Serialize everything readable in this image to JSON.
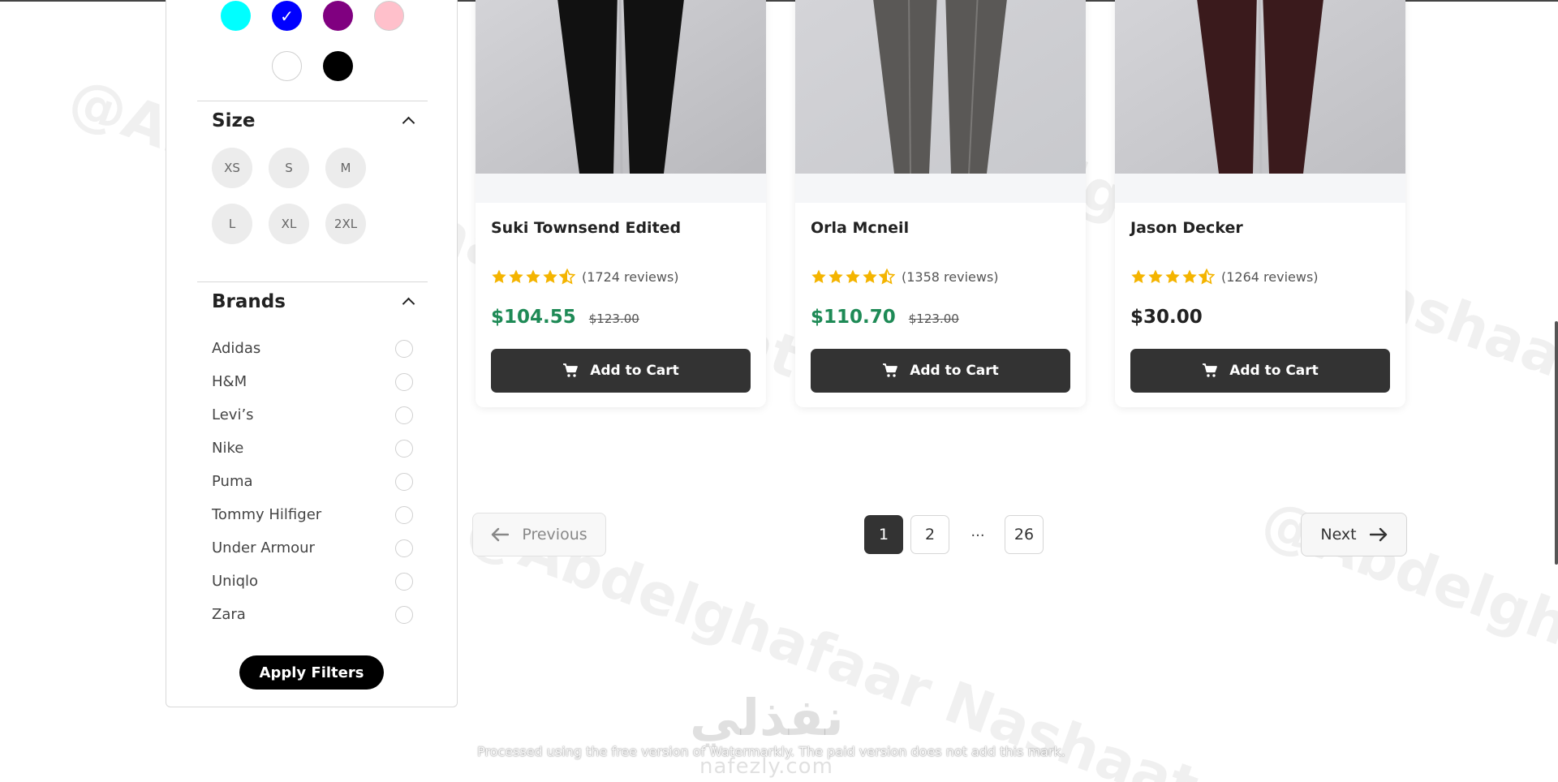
{
  "filters": {
    "colors": {
      "row1": [
        {
          "hex": "#00ffff",
          "selected": false
        },
        {
          "hex": "#0000ff",
          "selected": true
        },
        {
          "hex": "#800080",
          "selected": false
        },
        {
          "hex": "#ffc0cb",
          "selected": false
        }
      ],
      "row2": [
        {
          "hex": "#ffffff",
          "selected": false
        },
        {
          "hex": "#000000",
          "selected": false
        }
      ],
      "check_glyph": "✓"
    },
    "size": {
      "title": "Size",
      "row1": [
        "XS",
        "S",
        "M"
      ],
      "row2": [
        "L",
        "XL",
        "2XL"
      ]
    },
    "brands": {
      "title": "Brands",
      "items": [
        "Adidas",
        "H&M",
        "Levi’s",
        "Nike",
        "Puma",
        "Tommy Hilfiger",
        "Under Armour",
        "Uniqlo",
        "Zara"
      ]
    },
    "apply_label": "Apply Filters"
  },
  "products": [
    {
      "title": "Suki Townsend Edited",
      "reviews": "(1724 reviews)",
      "rating": 4.5,
      "price": "$104.55",
      "old_price": "$123.00",
      "cart_label": "Add to Cart",
      "pants_color": "#111111",
      "bg_color": "#b9b9bd"
    },
    {
      "title": "Orla Mcneil",
      "reviews": "(1358 reviews)",
      "rating": 4.5,
      "price": "$110.70",
      "old_price": "$123.00",
      "cart_label": "Add to Cart",
      "pants_color": "#5a5856",
      "bg_color": "#c8c9cd"
    },
    {
      "title": "Jason Decker",
      "reviews": "(1264 reviews)",
      "rating": 4.5,
      "price": "$30.00",
      "old_price": "",
      "cart_label": "Add to Cart",
      "pants_color": "#3a1a1c",
      "bg_color": "#bfbfc3"
    }
  ],
  "pagination": {
    "previous_label": "Previous",
    "next_label": "Next",
    "pages": [
      "1",
      "2",
      "26"
    ],
    "ellipsis": "...",
    "current": "1"
  },
  "watermark": {
    "text": "@Abdelghafaar Nashaat",
    "logo": "نفذلي",
    "logo_sub": "nafezly.com",
    "notice": "Processed using the free version of Watermarkly. The paid version does not add this mark."
  },
  "colors": {
    "accent_price": "#1e8a56",
    "button_dark": "#333333",
    "star": "#f4b400"
  }
}
